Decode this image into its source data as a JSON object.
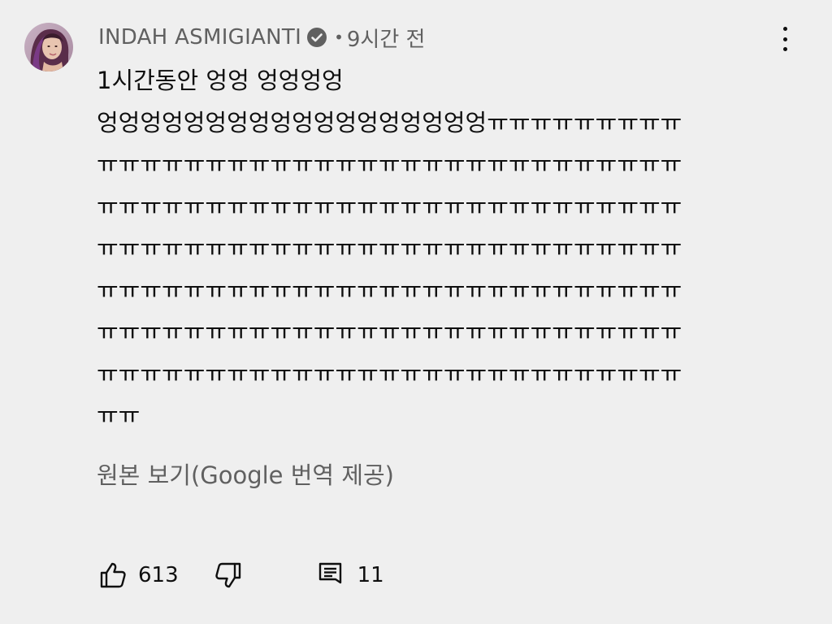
{
  "comment": {
    "author": "INDAH ASMIGIANTI",
    "separator": "•",
    "timestamp": "9시간 전",
    "lines": [
      "1시간동안 엉엉 엉엉엉엉",
      "엉엉엉엉엉엉엉엉엉엉엉엉엉엉엉엉엉엉ㅠㅠㅠㅠㅠㅠㅠㅠㅠ",
      "ㅠㅠㅠㅠㅠㅠㅠㅠㅠㅠㅠㅠㅠㅠㅠㅠㅠㅠㅠㅠㅠㅠㅠㅠㅠㅠㅠ",
      "ㅠㅠㅠㅠㅠㅠㅠㅠㅠㅠㅠㅠㅠㅠㅠㅠㅠㅠㅠㅠㅠㅠㅠㅠㅠㅠㅠ",
      "ㅠㅠㅠㅠㅠㅠㅠㅠㅠㅠㅠㅠㅠㅠㅠㅠㅠㅠㅠㅠㅠㅠㅠㅠㅠㅠㅠ",
      "ㅠㅠㅠㅠㅠㅠㅠㅠㅠㅠㅠㅠㅠㅠㅠㅠㅠㅠㅠㅠㅠㅠㅠㅠㅠㅠㅠ",
      "ㅠㅠㅠㅠㅠㅠㅠㅠㅠㅠㅠㅠㅠㅠㅠㅠㅠㅠㅠㅠㅠㅠㅠㅠㅠㅠㅠ",
      "ㅠㅠㅠㅠㅠㅠㅠㅠㅠㅠㅠㅠㅠㅠㅠㅠㅠㅠㅠㅠㅠㅠㅠㅠㅠㅠㅠ",
      "ㅠㅠ"
    ],
    "translate_link": "원본 보기(Google 번역 제공)"
  },
  "actions": {
    "like_count": "613",
    "reply_count": "11"
  },
  "icons": {
    "verified": "verified-check-icon",
    "more": "more-vert-icon",
    "like": "thumbs-up-icon",
    "dislike": "thumbs-down-icon",
    "reply": "comment-icon"
  },
  "colors": {
    "background": "#efefef",
    "text": "#0f0f0f",
    "secondary_text": "#606060",
    "verified_badge": "#606060"
  }
}
